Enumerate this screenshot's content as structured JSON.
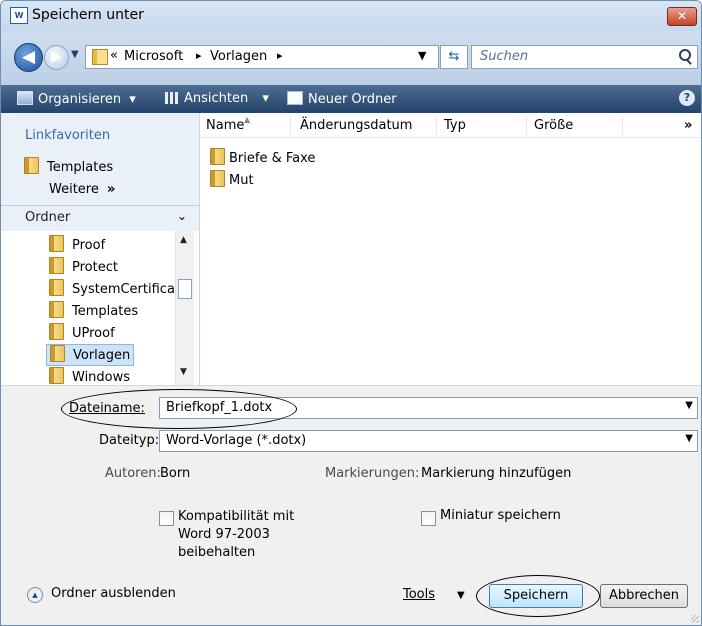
{
  "window": {
    "title": "Speichern unter",
    "close_label": "✕"
  },
  "address": {
    "chevrons": "«",
    "segments": [
      "Microsoft",
      "Vorlagen"
    ],
    "separator": "▸",
    "search_placeholder": "Suchen"
  },
  "toolbar": {
    "organize": "Organisieren",
    "views": "Ansichten",
    "new_folder": "Neuer Ordner",
    "dropdown_glyph": "▾",
    "help": "?"
  },
  "nav": {
    "favorites_header": "Linkfavoriten",
    "favorites": [
      {
        "label": "Templates"
      }
    ],
    "more": "Weitere",
    "more_glyph": "»",
    "folders_header": "Ordner",
    "tree": [
      {
        "label": "Proof"
      },
      {
        "label": "Protect"
      },
      {
        "label": "SystemCertificat"
      },
      {
        "label": "Templates"
      },
      {
        "label": "UProof"
      },
      {
        "label": "Vorlagen",
        "selected": true
      },
      {
        "label": "Windows"
      }
    ]
  },
  "filelist": {
    "columns": [
      "Name",
      "Änderungsdatum",
      "Typ",
      "Größe"
    ],
    "more_columns": "»",
    "items": [
      {
        "label": "Briefe & Faxe"
      },
      {
        "label": "Mut"
      }
    ]
  },
  "form": {
    "filename_label": "Dateiname:",
    "filename_value": "Briefkopf_1.dotx",
    "filetype_label": "Dateityp:",
    "filetype_value": "Word-Vorlage (*.dotx)",
    "authors_label": "Autoren:",
    "authors_value": "Born",
    "tags_label": "Markierungen:",
    "tags_value": "Markierung hinzufügen",
    "compat_lines": [
      "Kompatibilität mit",
      "Word 97-2003",
      "beibehalten"
    ],
    "thumbnail_label": "Miniatur speichern"
  },
  "footer": {
    "toggle_folders": "Ordner ausblenden",
    "tools": "Tools",
    "save": "Speichern",
    "cancel": "Abbrechen"
  },
  "colors": {
    "toolbar": "#2f4f78",
    "nav_bg": "#e9f0f8",
    "link": "#3e6aa3",
    "selection": "#cde3fa"
  }
}
